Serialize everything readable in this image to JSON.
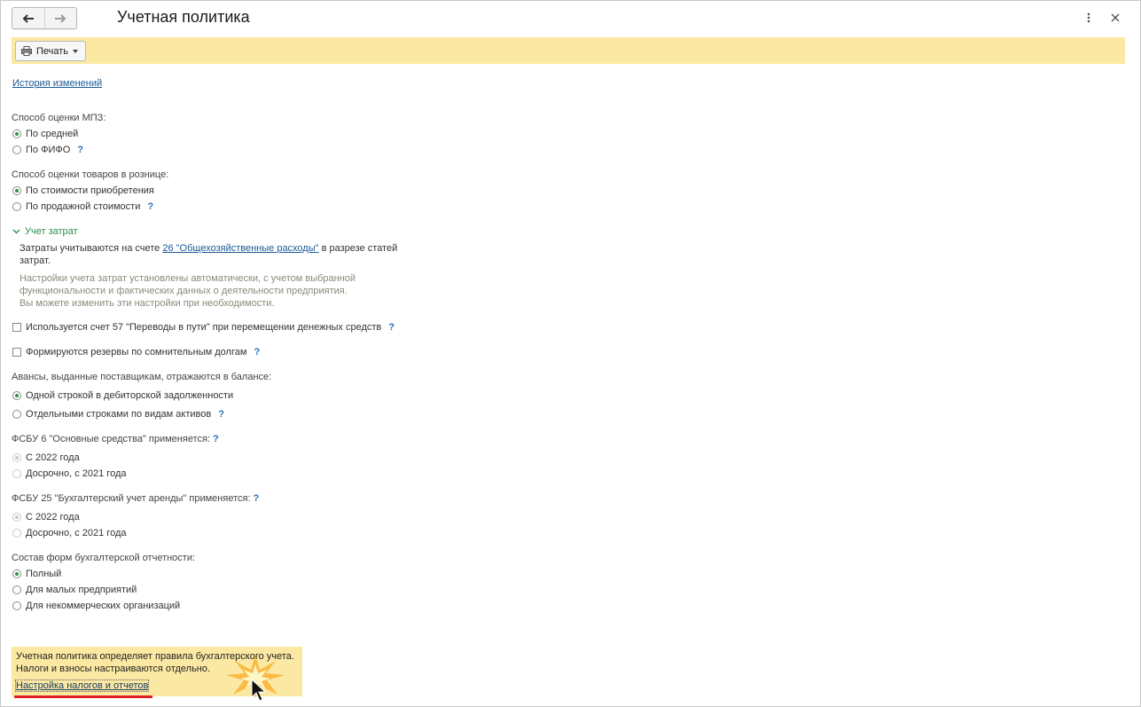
{
  "window": {
    "title": "Учетная политика"
  },
  "toolbar": {
    "print_label": "Печать"
  },
  "history_link": "История изменений",
  "mpz": {
    "label": "Способ оценки МПЗ:",
    "options": [
      "По средней",
      "По ФИФО"
    ],
    "help": "?"
  },
  "retail": {
    "label": "Способ оценки товаров в рознице:",
    "options": [
      "По стоимости приобретения",
      "По продажной стоимости"
    ],
    "help": "?"
  },
  "costs": {
    "group_label": "Учет затрат",
    "line1_prefix": "Затраты учитываются на счете ",
    "line1_link": "26 \"Общехозяйственные расходы\"",
    "line1_suffix": " в разрезе статей",
    "line2": "затрат.",
    "note1": "Настройки учета затрат установлены автоматически, с учетом выбранной",
    "note2": "функциональности и фактических данных о деятельности предприятия.",
    "note3": "Вы можете изменить эти настройки при необходимости."
  },
  "checks": {
    "account57": "Используется счет 57 \"Переводы в пути\" при перемещении денежных средств",
    "reserves": "Формируются резервы по сомнительным долгам",
    "help": "?"
  },
  "advances": {
    "label": "Авансы, выданные поставщикам, отражаются в балансе:",
    "options": [
      "Одной строкой в дебиторской задолженности",
      "Отдельными строками по видам активов"
    ],
    "help": "?"
  },
  "fsbu6": {
    "label": "ФСБУ 6 \"Основные средства\" применяется:",
    "options": [
      "С 2022 года",
      "Досрочно, с 2021 года"
    ],
    "help": "?"
  },
  "fsbu25": {
    "label": "ФСБУ 25 \"Бухгалтерский учет аренды\" применяется:",
    "options": [
      "С 2022 года",
      "Досрочно, с 2021 года"
    ],
    "help": "?"
  },
  "forms": {
    "label": "Состав форм бухгалтерской отчетности:",
    "options": [
      "Полный",
      "Для малых предприятий",
      "Для некоммерческих организаций"
    ]
  },
  "info": {
    "line1": "Учетная политика определяет правила бухгалтерского учета.",
    "line2": "Налоги и взносы настраиваются отдельно.",
    "link": "Настройка налогов и отчетов"
  },
  "colors": {
    "accent_green": "#2f8e4c",
    "link_blue": "#1a5a96",
    "panel_yellow": "#fbe9a3",
    "highlight_red": "#e02020"
  }
}
